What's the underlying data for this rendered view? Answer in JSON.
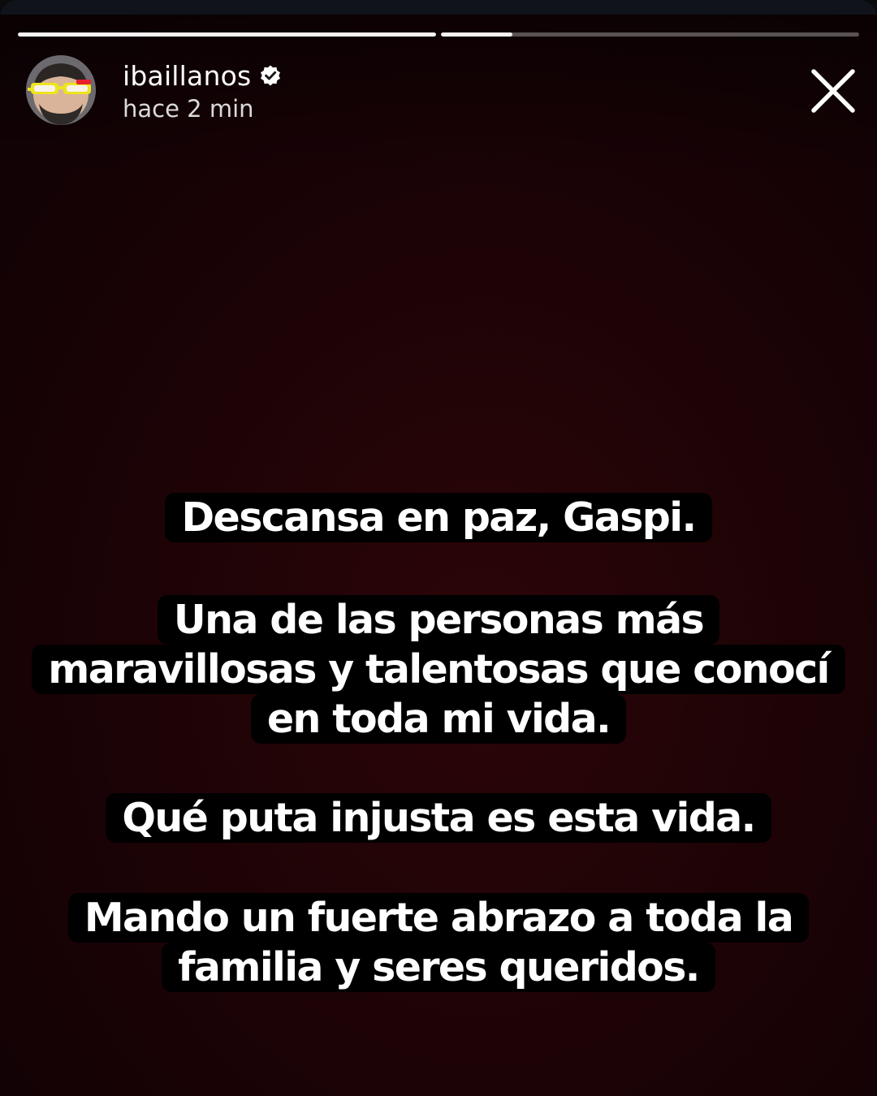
{
  "story": {
    "progress": [
      {
        "segment": 1,
        "filled": 1.0
      },
      {
        "segment": 2,
        "filled": 0.17
      }
    ],
    "user": {
      "username": "ibaillanos",
      "verified": true,
      "avatar_icon": "avatar-photo",
      "timestamp": "hace 2 min"
    },
    "close_icon": "close-icon",
    "background_color": "#1d0306",
    "caption_blocks": [
      {
        "lines": [
          "Descansa en paz, Gaspi."
        ]
      },
      {
        "lines": [
          "Una de las personas más",
          "maravillosas y talentosas que conocí",
          "en toda mi vida."
        ]
      },
      {
        "lines": [
          "Qué puta injusta es esta vida."
        ]
      },
      {
        "lines": [
          "Mando un fuerte abrazo a toda la",
          "familia y seres queridos."
        ]
      }
    ]
  }
}
